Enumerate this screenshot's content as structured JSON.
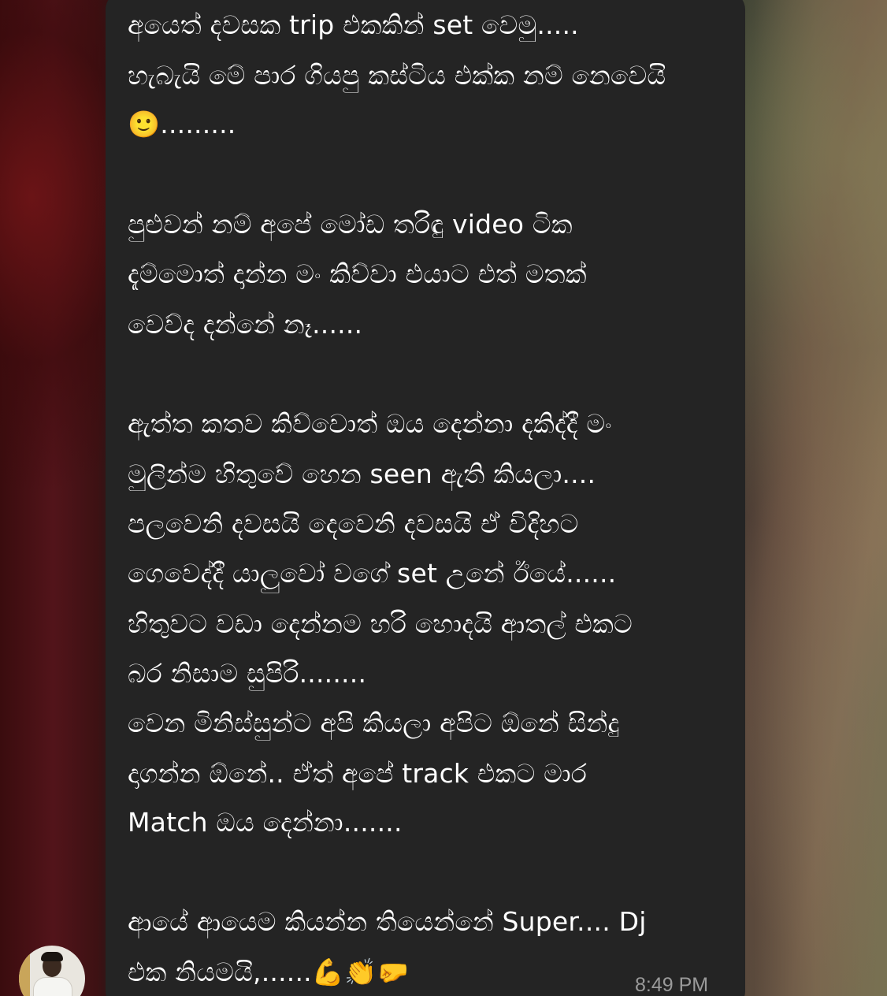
{
  "chat": {
    "message_lines": [
      "අයෙත් දවසක trip එකකින් set වෙමු.....",
      "හැබැයි මේ පාර ගියපු කස්ටිය එක්ක නම් නෙවෙයි",
      "🙂.........",
      "පුළුවන් නම් අපේ මෝඩ තරිඳු video ටික",
      "දැම්මොත් දාන්න මං කිව්වා එයාට එත් මතක්",
      "වෙව්ද දන්නේ නෑ......",
      "ඇත්ත කතව කිව්වොත් ඔය දෙන්නා දකිද්දී මං",
      "මුලින්ම හිතුවේ හෙන seen ඇති කියලා....",
      "පලවෙනි දවසයි දෙවෙනි දවසයි ඒ විදිහට",
      "ගෙවෙද්දී යාලුවෝ වගේ set උනේ ඊයේ......",
      "හිතුවට වඩා දෙන්නම හරි හොදයි ආතල් එකට",
      "බර නිසාම සුපිරි........",
      "වෙන මිනිස්සුන්ට අපි කියලා අපිට ඕනේ සින්දු",
      "දාගන්න ඕනේ.. ඒත් අපේ track එකට මාර",
      "Match ඔය දෙන්නා.......",
      "ආයේ ආයෙම කියන්න තියෙන්නේ Super.... Dj",
      "එක නියමයි,......💪👏🤛"
    ],
    "timestamp": "8:49 PM"
  }
}
